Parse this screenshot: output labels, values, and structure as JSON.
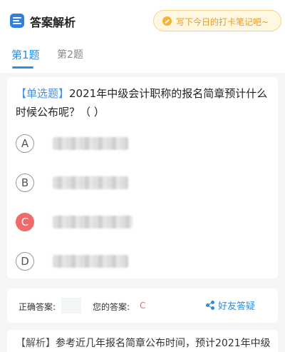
{
  "header": {
    "title": "答案解析",
    "note_prompt": "写下今日的打卡笔记吧~",
    "logo_icon": "answer-analysis-icon"
  },
  "tabs": [
    {
      "label": "第1题",
      "active": true
    },
    {
      "label": "第2题",
      "active": false
    }
  ],
  "question": {
    "type_tag": "【单选题】",
    "text": "2021年中级会计职称的报名简章预计什么时候公布呢？（    ）",
    "options": [
      {
        "letter": "A",
        "selected": false
      },
      {
        "letter": "B",
        "selected": false
      },
      {
        "letter": "C",
        "selected": true
      },
      {
        "letter": "D",
        "selected": false
      }
    ]
  },
  "answer_bar": {
    "correct_label": "正确答案:",
    "yours_label": "您的答案:",
    "yours_value": "C",
    "ask_friend_label": "好友答疑",
    "share_icon": "share-icon"
  },
  "analysis": {
    "tag": "【解析】",
    "text": "参考近几年报名简章公布时间，预计2021年中级"
  },
  "colors": {
    "accent": "#2d8ee0",
    "selected_option": "#ef6a6a",
    "note_text": "#e79b2a"
  }
}
